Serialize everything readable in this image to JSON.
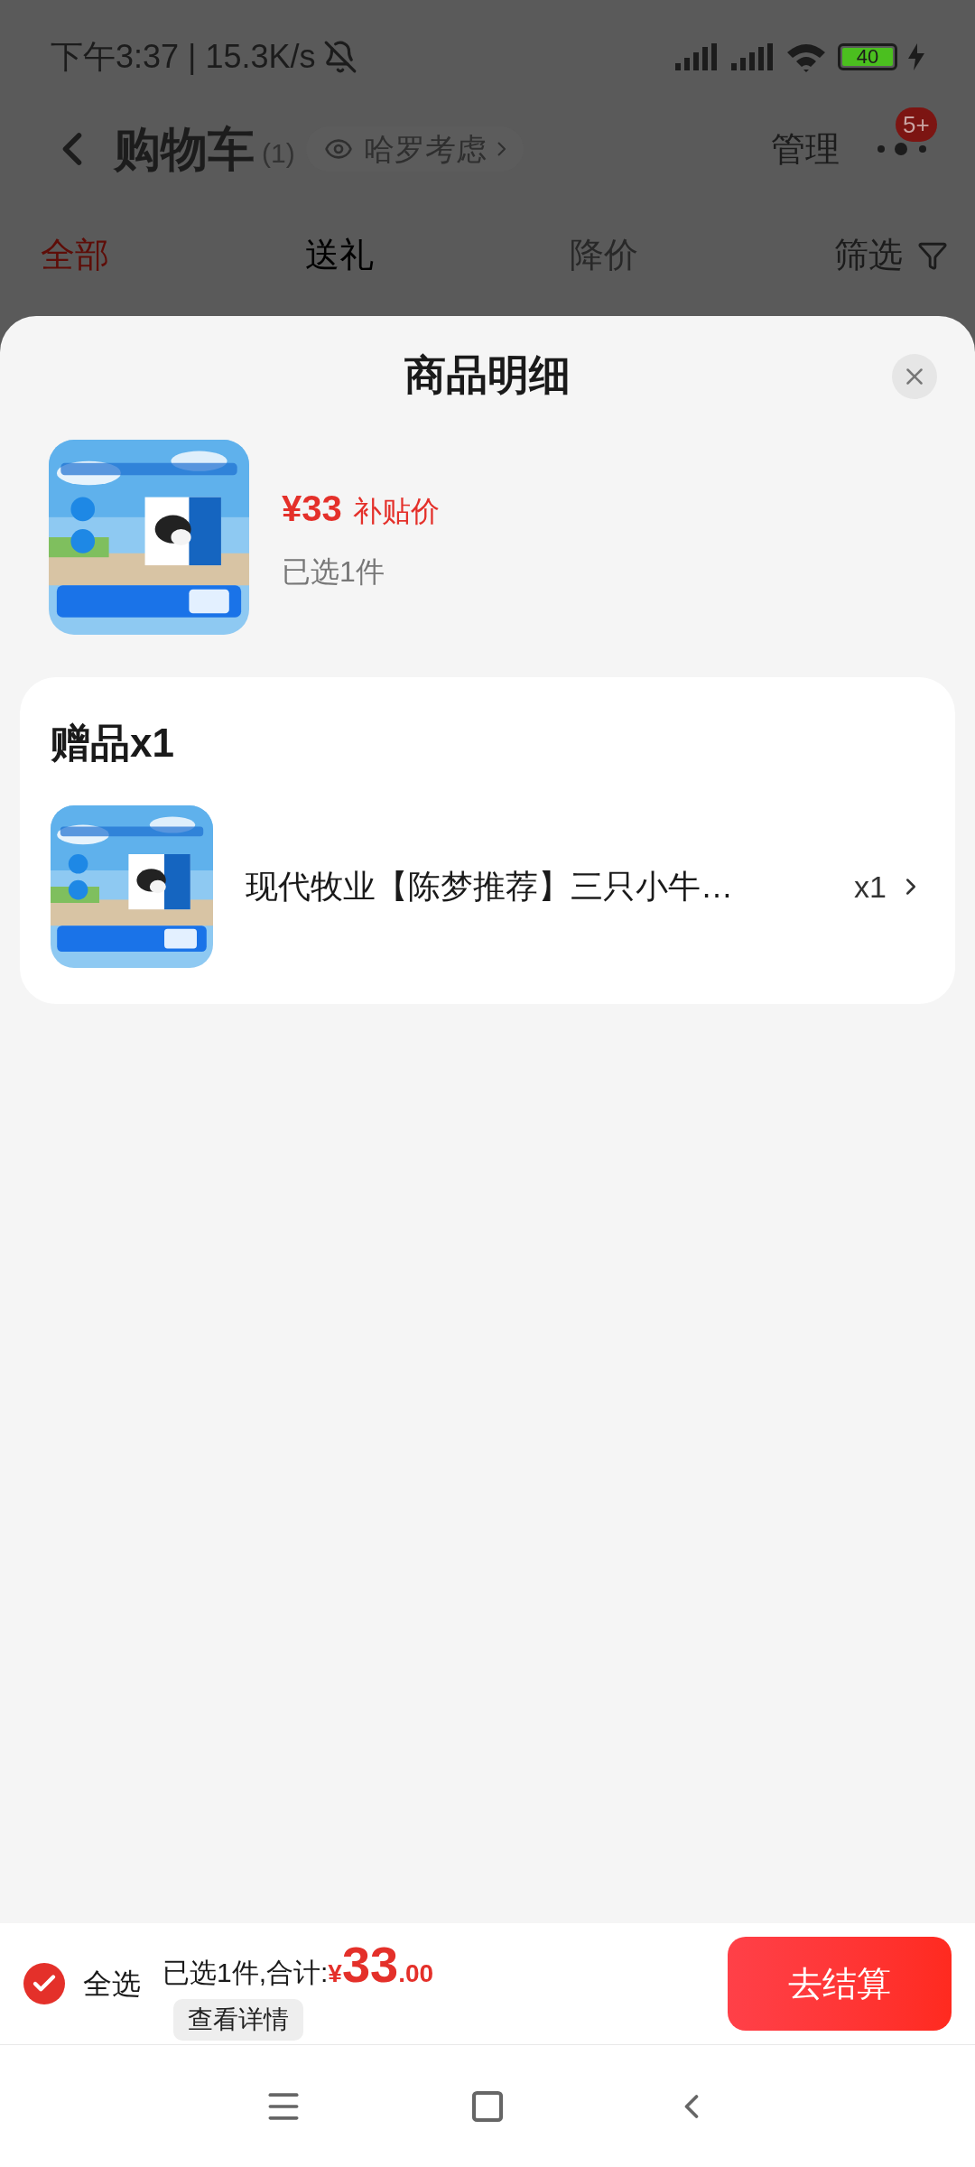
{
  "status_bar": {
    "time": "下午3:37 | 15.3K/s",
    "battery": "40"
  },
  "header": {
    "title": "购物车",
    "count": "(1)",
    "consider": "哈罗考虑",
    "manage": "管理",
    "badge": "5+"
  },
  "tabs": [
    {
      "label": "全部",
      "selected": true,
      "disabled": false
    },
    {
      "label": "送礼",
      "selected": false,
      "disabled": false
    },
    {
      "label": "降价",
      "selected": false,
      "disabled": true
    }
  ],
  "filter": "筛选",
  "sheet": {
    "title": "商品明细",
    "product": {
      "price": "¥33",
      "price_tag": "补贴价",
      "selected_count": "已选1件"
    },
    "gift": {
      "title": "赠品x1",
      "item": {
        "name": "现代牧业【陈梦推荐】三只小牛…",
        "quantity": "x1"
      }
    }
  },
  "bottom_bar": {
    "select_all": {
      "label": "全选",
      "checked": true
    },
    "summary": "已选1件,合计:",
    "currency": "¥",
    "total_int": "33",
    "total_dec": ".00",
    "details": "查看详情",
    "checkout": "去结算"
  }
}
